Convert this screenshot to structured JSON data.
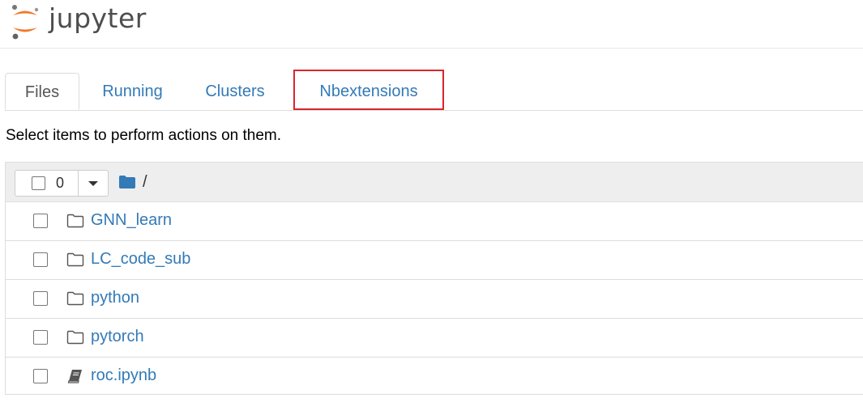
{
  "header": {
    "logo_text": "jupyter"
  },
  "tabs": [
    {
      "label": "Files",
      "active": true
    },
    {
      "label": "Running",
      "active": false
    },
    {
      "label": "Clusters",
      "active": false
    },
    {
      "label": "Nbextensions",
      "active": false,
      "highlighted": true
    }
  ],
  "hint": "Select items to perform actions on them.",
  "file_list": {
    "selected_count": "0",
    "breadcrumb": "/",
    "items": [
      {
        "name": "GNN_learn",
        "icon": "folder-icon"
      },
      {
        "name": "LC_code_sub",
        "icon": "folder-icon"
      },
      {
        "name": "python",
        "icon": "folder-icon"
      },
      {
        "name": "pytorch",
        "icon": "folder-icon"
      },
      {
        "name": "roc.ipynb",
        "icon": "notebook-icon"
      }
    ]
  },
  "colors": {
    "link": "#337ab7",
    "highlight_border": "#d9262d",
    "logo_orange": "#f37726"
  }
}
